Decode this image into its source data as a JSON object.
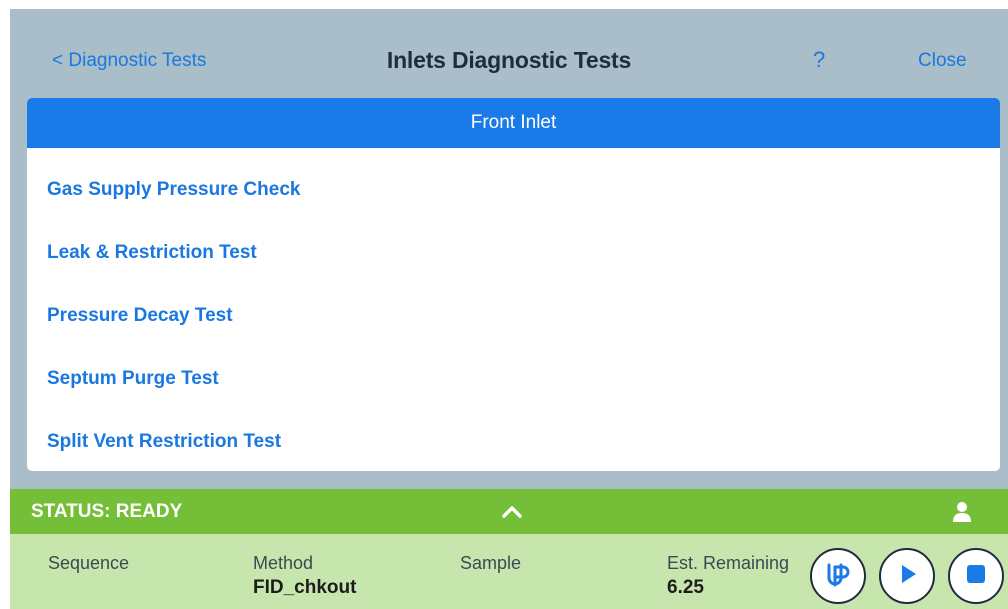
{
  "header": {
    "back_label": "< Diagnostic Tests",
    "title": "Inlets Diagnostic Tests",
    "help_label": "?",
    "close_label": "Close"
  },
  "panel": {
    "title": "Front Inlet",
    "tests": [
      "Gas Supply Pressure Check",
      "Leak & Restriction Test",
      "Pressure Decay Test",
      "Septum Purge Test",
      "Split Vent Restriction Test"
    ]
  },
  "status": {
    "text": "STATUS: READY",
    "expand_icon": "chevron-up-icon",
    "user_icon": "user-icon"
  },
  "run_info": {
    "sequence_label": "Sequence",
    "sequence_value": "",
    "method_label": "Method",
    "method_value": "FID_chkout",
    "sample_label": "Sample",
    "sample_value": "",
    "remaining_label": "Est. Remaining",
    "remaining_value": "6.25"
  },
  "controls": {
    "prep_run_icon": "prep-run-icon",
    "start_icon": "play-icon",
    "stop_icon": "stop-icon"
  },
  "colors": {
    "accent_blue": "#1a7ae8",
    "background": "#a9bec9",
    "status_green": "#74bf37",
    "info_green": "#c7e6ad"
  }
}
